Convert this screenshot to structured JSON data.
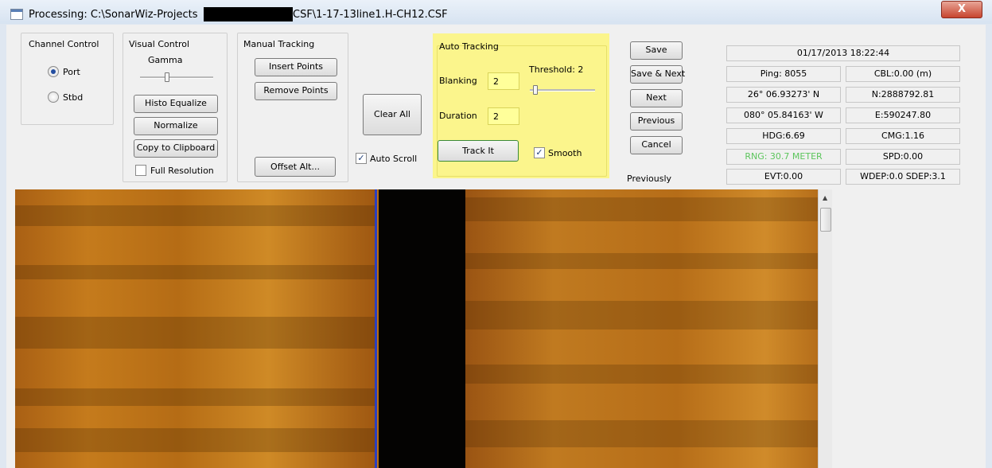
{
  "window": {
    "title_prefix": "Processing: C:\\SonarWiz-Projects",
    "title_suffix": "CSF\\1-17-13line1.H-CH12.CSF",
    "close_label": "X"
  },
  "channel_control": {
    "label": "Channel Control",
    "port_label": "Port",
    "stbd_label": "Stbd",
    "selected": "Port"
  },
  "visual_control": {
    "label": "Visual Control",
    "gamma_label": "Gamma",
    "histo_label": "Histo Equalize",
    "normalize_label": "Normalize",
    "clipboard_label": "Copy to Clipboard",
    "full_res_label": "Full Resolution",
    "full_res_checked": false
  },
  "manual_tracking": {
    "label": "Manual Tracking",
    "insert_label": "Insert Points",
    "remove_label": "Remove Points",
    "offset_label": "Offset Alt..."
  },
  "clear_all_label": "Clear All",
  "auto_scroll": {
    "label": "Auto Scroll",
    "checked": true,
    "mark": "✓"
  },
  "auto_tracking": {
    "label": "Auto Tracking",
    "blanking_label": "Blanking",
    "blanking_value": "2",
    "duration_label": "Duration",
    "duration_value": "2",
    "threshold_label": "Threshold: 2",
    "track_label": "Track It",
    "smooth_label": "Smooth",
    "smooth_checked": true,
    "smooth_mark": "✓",
    "highlight_color": "#fbf58c"
  },
  "nav_buttons": {
    "save": "Save",
    "save_next": "Save & Next",
    "next": "Next",
    "previous": "Previous",
    "cancel": "Cancel",
    "previously": "Previously"
  },
  "info": {
    "datetime": "01/17/2013 18:22:44",
    "ping": "Ping: 8055",
    "cbl": "CBL:0.00 (m)",
    "lat": "26° 06.93273' N",
    "northing": "N:2888792.81",
    "lon": "080° 05.84163' W",
    "easting": "E:590247.80",
    "hdg": "HDG:6.69",
    "cmg": "CMG:1.16",
    "rng": "RNG: 30.7 METER",
    "rng_color": "#5cc55c",
    "spd": "SPD:0.00",
    "evt": "EVT:0.00",
    "wdep": "WDEP:0.0 SDEP:3.1"
  },
  "sonar": {
    "blue_line_color": "#2b3fbf",
    "water_column_color": "#040302"
  },
  "icons": {
    "scroll_up": "▲"
  }
}
